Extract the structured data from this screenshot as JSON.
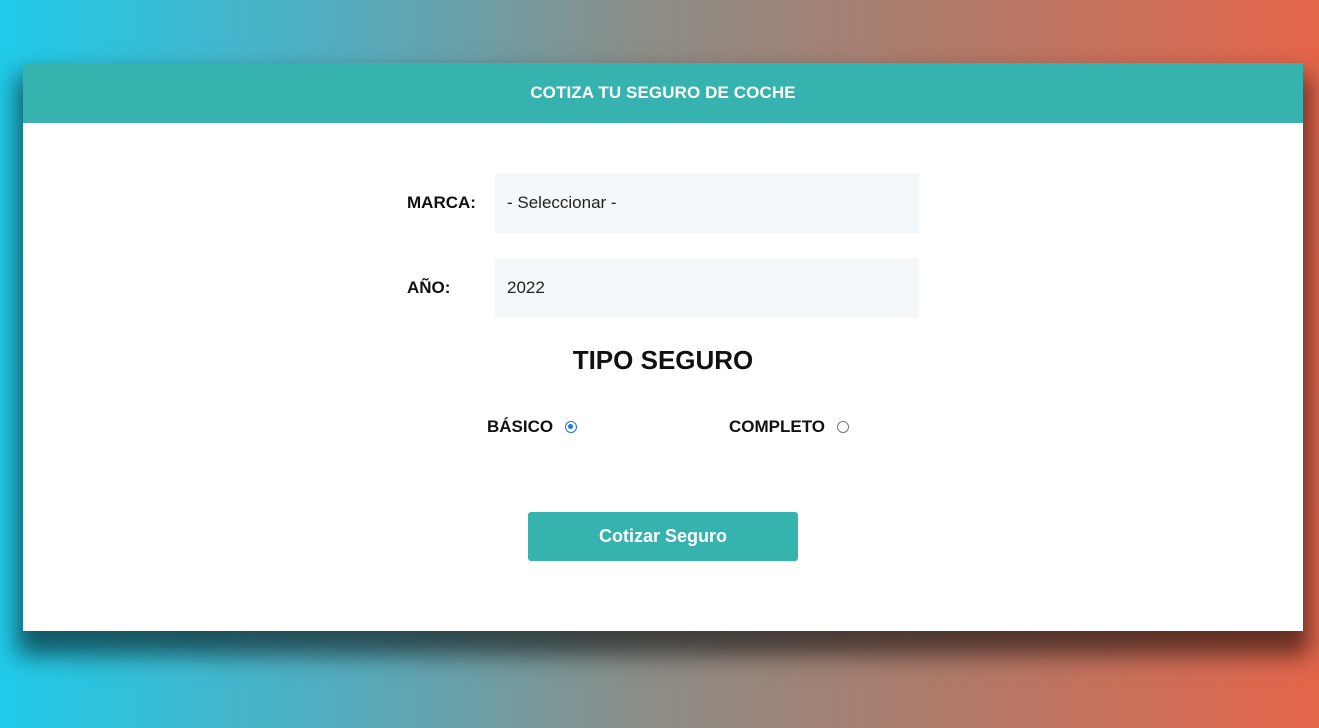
{
  "header": {
    "title": "COTIZA TU SEGURO DE COCHE"
  },
  "form": {
    "brand": {
      "label": "MARCA:",
      "selected": "- Seleccionar -"
    },
    "year": {
      "label": "AÑO:",
      "selected": "2022"
    },
    "insurance_type": {
      "title": "TIPO SEGURO",
      "options": [
        {
          "label": "BÁSICO",
          "checked": true
        },
        {
          "label": "COMPLETO",
          "checked": false
        }
      ]
    },
    "submit_label": "Cotizar Seguro"
  },
  "colors": {
    "accent": "#37b3af",
    "radio_checked": "#1a73e8",
    "input_bg": "#f5f8fa"
  }
}
